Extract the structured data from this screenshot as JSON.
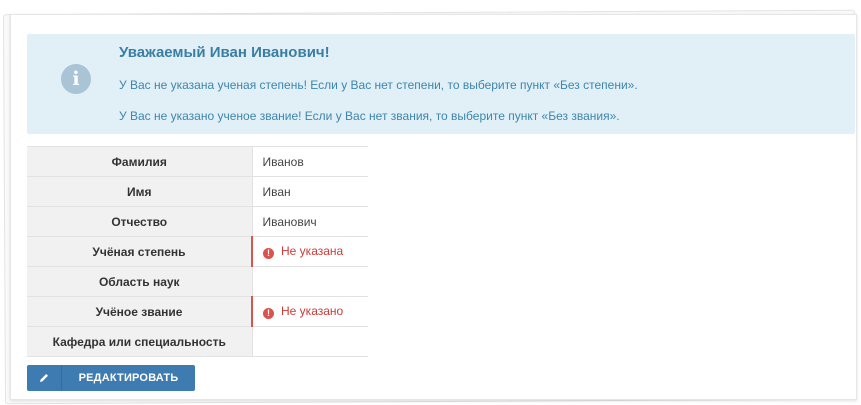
{
  "alert": {
    "icon": "info-icon",
    "title": "Уважаемый Иван Иванович!",
    "line1": "У Вас не указана ученая степень! Если у Вас нет степени, то выберите пункт «Без степени».",
    "line2": "У Вас не указано ученое звание! Если у Вас нет звания, то выберите пункт «Без звания»."
  },
  "profile": {
    "rows": [
      {
        "label": "Фамилия",
        "value": "Иванов",
        "error": false
      },
      {
        "label": "Имя",
        "value": "Иван",
        "error": false
      },
      {
        "label": "Отчество",
        "value": "Иванович",
        "error": false
      },
      {
        "label": "Учёная степень",
        "value": "Не указана",
        "error": true
      },
      {
        "label": "Область наук",
        "value": "",
        "error": false
      },
      {
        "label": "Учёное звание",
        "value": "Не указано",
        "error": true
      },
      {
        "label": "Кафедра или специальность",
        "value": "",
        "error": false
      }
    ]
  },
  "edit_button": {
    "icon": "pencil-icon",
    "label": "РЕДАКТИРОВАТЬ"
  },
  "colors": {
    "alert_bg": "#e1eff6",
    "alert_text": "#3d86ad",
    "error": "#d9534f",
    "button": "#3e7bb0"
  }
}
